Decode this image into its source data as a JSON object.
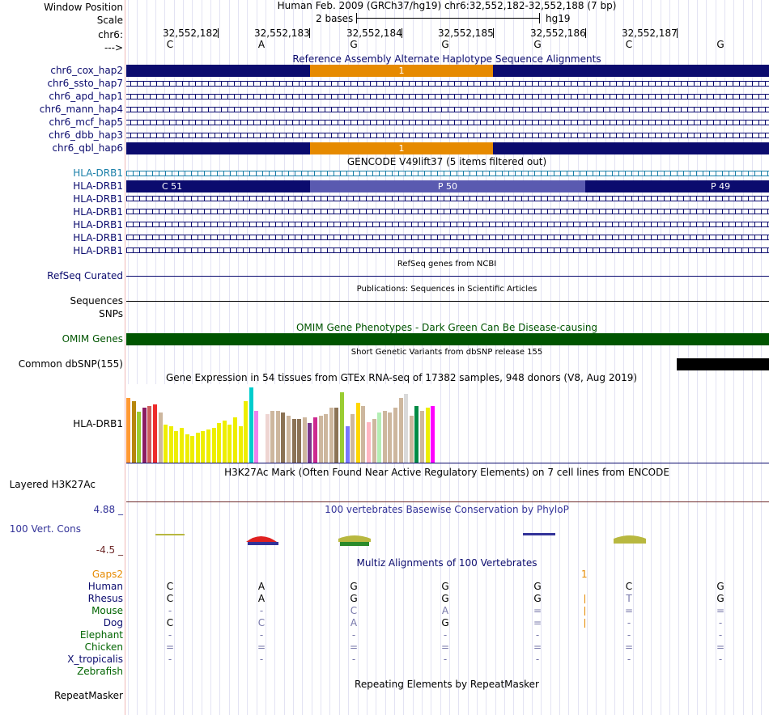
{
  "labels": {
    "window_position": "Window Position",
    "scale": "Scale",
    "chrom": "chr6:",
    "strand": "--->",
    "alt_haps": [
      "chr6_cox_hap2",
      "chr6_ssto_hap7",
      "chr6_apd_hap1",
      "chr6_mann_hap4",
      "chr6_mcf_hap5",
      "chr6_dbb_hap3",
      "chr6_qbl_hap6"
    ],
    "gencode_genes": [
      "HLA-DRB1",
      "HLA-DRB1",
      "HLA-DRB1",
      "HLA-DRB1",
      "HLA-DRB1",
      "HLA-DRB1",
      "HLA-DRB1"
    ],
    "refseq": "RefSeq Curated",
    "sequences": "Sequences",
    "snps": "SNPs",
    "omim": "OMIM Genes",
    "dbsnp": "Common dbSNP(155)",
    "gtex_gene": "HLA-DRB1",
    "h3k27ac": "Layered H3K27Ac",
    "cons_max": "4.88 _",
    "cons_name": "100 Vert. Cons",
    "cons_min": "-4.5 _",
    "gaps": "Gaps2",
    "species": [
      "Human",
      "Rhesus",
      "Mouse",
      "Dog",
      "Elephant",
      "Chicken",
      "X_tropicalis",
      "Zebrafish"
    ],
    "repeatmasker": "RepeatMasker"
  },
  "header": {
    "assembly": "Human Feb. 2009 (GRCh37/hg19)   chr6:32,552,182-32,552,188 (7 bp)",
    "scale_text": "2 bases",
    "scale_db": "hg19",
    "positions": [
      "32,552,182",
      "32,552,183",
      "32,552,184",
      "32,552,185",
      "32,552,186",
      "32,552,187"
    ],
    "bases": [
      "C",
      "A",
      "G",
      "G",
      "G",
      "C",
      "G"
    ]
  },
  "titles": {
    "alt_haps": "Reference Assembly Alternate Haplotype Sequence Alignments",
    "gencode": "GENCODE V49lift37 (5 items filtered out)",
    "refseq": "RefSeq genes from NCBI",
    "publications": "Publications: Sequences in Scientific Articles",
    "omim": "OMIM Gene Phenotypes - Dark Green Can Be Disease-causing",
    "dbsnp": "Short Genetic Variants from dbSNP release 155",
    "gtex": "Gene Expression in 54 tissues from GTEx RNA-seq of 17382 samples, 948 donors (V8, Aug 2019)",
    "h3k27ac": "H3K27Ac Mark (Often Found Near Active Regulatory Elements) on 7 cell lines from ENCODE",
    "phylop": "100 vertebrates Basewise Conservation by PhyloP",
    "multiz": "Multiz Alignments of 100 Vertebrates",
    "repeatmasker": "Repeating Elements by RepeatMasker"
  },
  "hap_mid_label": "1",
  "gencode_exons": {
    "left": "C 51",
    "mid": "P 50",
    "right": "P 49"
  },
  "gaps_value": "1",
  "multiz_rows": [
    [
      "C",
      "A",
      "G",
      "G",
      "G",
      "C",
      "G"
    ],
    [
      "C",
      "A",
      "G",
      "G",
      "G",
      "",
      "G"
    ],
    [
      "-",
      "-",
      "C",
      "A",
      "=",
      "=",
      "="
    ],
    [
      "C",
      "C",
      "A",
      "G",
      "=",
      "-",
      "-"
    ],
    [
      "-",
      "-",
      "-",
      "-",
      "-",
      "-",
      "-"
    ],
    [
      "=",
      "=",
      "=",
      "=",
      "=",
      "=",
      "="
    ],
    [
      "-",
      "-",
      "-",
      "-",
      "-",
      "-",
      "-"
    ],
    [
      "",
      "",
      "",
      "",
      "",
      "",
      ""
    ]
  ],
  "multiz_rhesus_alt": "T",
  "gtex_values": [
    82,
    78,
    65,
    70,
    72,
    74,
    64,
    48,
    46,
    40,
    44,
    36,
    34,
    38,
    40,
    42,
    44,
    50,
    54,
    48,
    58,
    46,
    78,
    96,
    66,
    44,
    62,
    66,
    66,
    64,
    60,
    56,
    56,
    58,
    50,
    58,
    60,
    62,
    70,
    70,
    90,
    46,
    62,
    76,
    72,
    52,
    56,
    64,
    66,
    64,
    70,
    82,
    88,
    60,
    72,
    66,
    70,
    72
  ],
  "gtex_colors": [
    "#FF9933",
    "#B8860B",
    "#9ACD32",
    "#8B1C62",
    "#CD5C5C",
    "#EE2C2C",
    "#CDB79E",
    "#EEEE00",
    "#EEEE00",
    "#EEEE00",
    "#EEEE00",
    "#EEEE00",
    "#EEEE00",
    "#EEEE00",
    "#EEEE00",
    "#EEEE00",
    "#EEEE00",
    "#EEEE00",
    "#EEEE00",
    "#EEEE00",
    "#EEEE00",
    "#EEEE00",
    "#EEEE00",
    "#00CDCD",
    "#EE82EE",
    "#FFFFFF",
    "#EED5D2",
    "#CDB79E",
    "#CDB79E",
    "#8B7355",
    "#CDB79E",
    "#8B7355",
    "#8B7355",
    "#CDB79E",
    "#7A378B",
    "#CD2990",
    "#CDB79E",
    "#CDB79E",
    "#CDB79E",
    "#8B7355",
    "#9ACD32",
    "#7777FF",
    "#CDB79E",
    "#FFD700",
    "#CDB79E",
    "#FFB6C1",
    "#CDB79E",
    "#B4EEB4",
    "#CDB79E",
    "#CDB79E",
    "#CDB79E",
    "#CDB79E",
    "#D9D9D9",
    "#CDB79E",
    "#008B45",
    "#CDB79E",
    "#EEEE00",
    "#FF00FF"
  ],
  "colors": {
    "navy": "#0b0b6e",
    "orange": "#e68a00",
    "omim_green": "#005500",
    "label_navy": "#0b0b6e",
    "gencode_light": "#1a7fa8",
    "gencode_mid": "#5a5ab0",
    "cons_blue": "#333399",
    "gaps_orange": "#e68a00",
    "species_green": "#006400",
    "h3k_line": "#6e2a2a"
  }
}
